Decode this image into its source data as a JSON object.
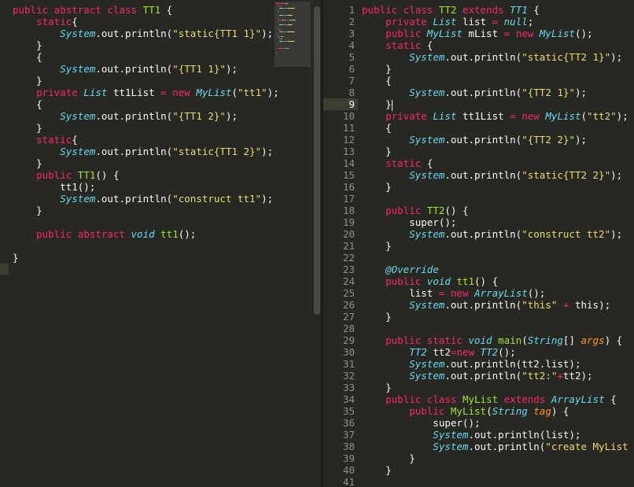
{
  "left_editor": {
    "lines": [
      [
        {
          "t": "public abstract class ",
          "c": "kw"
        },
        {
          "t": "TT1",
          "c": "fn"
        },
        {
          "t": " {",
          "c": "pl"
        }
      ],
      [
        {
          "t": "    ",
          "c": "pl"
        },
        {
          "t": "static",
          "c": "kw"
        },
        {
          "t": "{",
          "c": "pl"
        }
      ],
      [
        {
          "t": "        ",
          "c": "pl"
        },
        {
          "t": "System",
          "c": "ty"
        },
        {
          "t": ".out.println(",
          "c": "pl"
        },
        {
          "t": "\"static{TT1 1}\"",
          "c": "st"
        },
        {
          "t": ");",
          "c": "pl"
        }
      ],
      [
        {
          "t": "    }",
          "c": "pl"
        }
      ],
      [
        {
          "t": "    {",
          "c": "pl"
        }
      ],
      [
        {
          "t": "        ",
          "c": "pl"
        },
        {
          "t": "System",
          "c": "ty"
        },
        {
          "t": ".out.println(",
          "c": "pl"
        },
        {
          "t": "\"{TT1 1}\"",
          "c": "st"
        },
        {
          "t": ");",
          "c": "pl"
        }
      ],
      [
        {
          "t": "    }",
          "c": "pl"
        }
      ],
      [
        {
          "t": "    ",
          "c": "pl"
        },
        {
          "t": "private ",
          "c": "kw"
        },
        {
          "t": "List",
          "c": "ty"
        },
        {
          "t": " tt1List ",
          "c": "pl"
        },
        {
          "t": "=",
          "c": "op"
        },
        {
          "t": " ",
          "c": "pl"
        },
        {
          "t": "new ",
          "c": "kw"
        },
        {
          "t": "MyList",
          "c": "ty"
        },
        {
          "t": "(",
          "c": "pl"
        },
        {
          "t": "\"tt1\"",
          "c": "st"
        },
        {
          "t": ");",
          "c": "pl"
        }
      ],
      [
        {
          "t": "    {",
          "c": "pl"
        }
      ],
      [
        {
          "t": "        ",
          "c": "pl"
        },
        {
          "t": "System",
          "c": "ty"
        },
        {
          "t": ".out.println(",
          "c": "pl"
        },
        {
          "t": "\"{TT1 2}\"",
          "c": "st"
        },
        {
          "t": ");",
          "c": "pl"
        }
      ],
      [
        {
          "t": "    }",
          "c": "pl"
        }
      ],
      [
        {
          "t": "    ",
          "c": "pl"
        },
        {
          "t": "static",
          "c": "kw"
        },
        {
          "t": "{",
          "c": "pl"
        }
      ],
      [
        {
          "t": "        ",
          "c": "pl"
        },
        {
          "t": "System",
          "c": "ty"
        },
        {
          "t": ".out.println(",
          "c": "pl"
        },
        {
          "t": "\"static{TT1 2}\"",
          "c": "st"
        },
        {
          "t": ");",
          "c": "pl"
        }
      ],
      [
        {
          "t": "    }",
          "c": "pl"
        }
      ],
      [
        {
          "t": "    ",
          "c": "pl"
        },
        {
          "t": "public ",
          "c": "kw"
        },
        {
          "t": "TT1",
          "c": "fn"
        },
        {
          "t": "() {",
          "c": "pl"
        }
      ],
      [
        {
          "t": "        tt1();",
          "c": "pl"
        }
      ],
      [
        {
          "t": "        ",
          "c": "pl"
        },
        {
          "t": "System",
          "c": "ty"
        },
        {
          "t": ".out.println(",
          "c": "pl"
        },
        {
          "t": "\"construct tt1\"",
          "c": "st"
        },
        {
          "t": ");",
          "c": "pl"
        }
      ],
      [
        {
          "t": "    }",
          "c": "pl"
        }
      ],
      [
        {
          "t": "",
          "c": "pl"
        }
      ],
      [
        {
          "t": "    ",
          "c": "pl"
        },
        {
          "t": "public abstract ",
          "c": "kw"
        },
        {
          "t": "void",
          "c": "ty"
        },
        {
          "t": " ",
          "c": "pl"
        },
        {
          "t": "tt1",
          "c": "fn"
        },
        {
          "t": "();",
          "c": "pl"
        }
      ],
      [
        {
          "t": "",
          "c": "pl"
        }
      ],
      [
        {
          "t": "}",
          "c": "pl"
        }
      ]
    ]
  },
  "right_editor": {
    "active_line": 9,
    "lines": [
      [
        {
          "t": "public class ",
          "c": "kw"
        },
        {
          "t": "TT2",
          "c": "fn"
        },
        {
          "t": " ",
          "c": "pl"
        },
        {
          "t": "extends ",
          "c": "kw"
        },
        {
          "t": "TT1",
          "c": "ty"
        },
        {
          "t": " {",
          "c": "pl"
        }
      ],
      [
        {
          "t": "    ",
          "c": "pl"
        },
        {
          "t": "private ",
          "c": "kw"
        },
        {
          "t": "List",
          "c": "ty"
        },
        {
          "t": " list ",
          "c": "pl"
        },
        {
          "t": "=",
          "c": "op"
        },
        {
          "t": " ",
          "c": "pl"
        },
        {
          "t": "null",
          "c": "ty"
        },
        {
          "t": ";",
          "c": "pl"
        }
      ],
      [
        {
          "t": "    ",
          "c": "pl"
        },
        {
          "t": "public ",
          "c": "kw"
        },
        {
          "t": "MyList",
          "c": "ty"
        },
        {
          "t": " mList ",
          "c": "pl"
        },
        {
          "t": "=",
          "c": "op"
        },
        {
          "t": " ",
          "c": "pl"
        },
        {
          "t": "new ",
          "c": "kw"
        },
        {
          "t": "MyList",
          "c": "ty"
        },
        {
          "t": "();",
          "c": "pl"
        }
      ],
      [
        {
          "t": "    ",
          "c": "pl"
        },
        {
          "t": "static",
          "c": "kw"
        },
        {
          "t": " {",
          "c": "pl"
        }
      ],
      [
        {
          "t": "        ",
          "c": "pl"
        },
        {
          "t": "System",
          "c": "ty"
        },
        {
          "t": ".out.println(",
          "c": "pl"
        },
        {
          "t": "\"static{TT2 1}\"",
          "c": "st"
        },
        {
          "t": ");",
          "c": "pl"
        }
      ],
      [
        {
          "t": "    }",
          "c": "pl"
        }
      ],
      [
        {
          "t": "    {",
          "c": "pl"
        }
      ],
      [
        {
          "t": "        ",
          "c": "pl"
        },
        {
          "t": "System",
          "c": "ty"
        },
        {
          "t": ".out.println(",
          "c": "pl"
        },
        {
          "t": "\"{TT2 1}\"",
          "c": "st"
        },
        {
          "t": ");",
          "c": "pl"
        }
      ],
      [
        {
          "t": "    }",
          "c": "pl",
          "cursor": true
        }
      ],
      [
        {
          "t": "    ",
          "c": "pl"
        },
        {
          "t": "private ",
          "c": "kw"
        },
        {
          "t": "List",
          "c": "ty"
        },
        {
          "t": " tt1List ",
          "c": "pl"
        },
        {
          "t": "=",
          "c": "op"
        },
        {
          "t": " ",
          "c": "pl"
        },
        {
          "t": "new ",
          "c": "kw"
        },
        {
          "t": "MyList",
          "c": "ty"
        },
        {
          "t": "(",
          "c": "pl"
        },
        {
          "t": "\"tt2\"",
          "c": "st"
        },
        {
          "t": ");",
          "c": "pl"
        }
      ],
      [
        {
          "t": "    {",
          "c": "pl"
        }
      ],
      [
        {
          "t": "        ",
          "c": "pl"
        },
        {
          "t": "System",
          "c": "ty"
        },
        {
          "t": ".out.println(",
          "c": "pl"
        },
        {
          "t": "\"{TT2 2}\"",
          "c": "st"
        },
        {
          "t": ");",
          "c": "pl"
        }
      ],
      [
        {
          "t": "    }",
          "c": "pl"
        }
      ],
      [
        {
          "t": "    ",
          "c": "pl"
        },
        {
          "t": "static",
          "c": "kw"
        },
        {
          "t": " {",
          "c": "pl"
        }
      ],
      [
        {
          "t": "        ",
          "c": "pl"
        },
        {
          "t": "System",
          "c": "ty"
        },
        {
          "t": ".out.println(",
          "c": "pl"
        },
        {
          "t": "\"static{TT2 2}\"",
          "c": "st"
        },
        {
          "t": ");",
          "c": "pl"
        }
      ],
      [
        {
          "t": "    }",
          "c": "pl"
        }
      ],
      [
        {
          "t": "",
          "c": "pl"
        }
      ],
      [
        {
          "t": "    ",
          "c": "pl"
        },
        {
          "t": "public ",
          "c": "kw"
        },
        {
          "t": "TT2",
          "c": "fn"
        },
        {
          "t": "() {",
          "c": "pl"
        }
      ],
      [
        {
          "t": "        super();",
          "c": "pl"
        }
      ],
      [
        {
          "t": "        ",
          "c": "pl"
        },
        {
          "t": "System",
          "c": "ty"
        },
        {
          "t": ".out.println(",
          "c": "pl"
        },
        {
          "t": "\"construct tt2\"",
          "c": "st"
        },
        {
          "t": ");",
          "c": "pl"
        }
      ],
      [
        {
          "t": "    }",
          "c": "pl"
        }
      ],
      [
        {
          "t": "",
          "c": "pl"
        }
      ],
      [
        {
          "t": "    ",
          "c": "pl"
        },
        {
          "t": "@Override",
          "c": "an"
        }
      ],
      [
        {
          "t": "    ",
          "c": "pl"
        },
        {
          "t": "public ",
          "c": "kw"
        },
        {
          "t": "void",
          "c": "ty"
        },
        {
          "t": " ",
          "c": "pl"
        },
        {
          "t": "tt1",
          "c": "fn"
        },
        {
          "t": "() {",
          "c": "pl"
        }
      ],
      [
        {
          "t": "        list ",
          "c": "pl"
        },
        {
          "t": "=",
          "c": "op"
        },
        {
          "t": " ",
          "c": "pl"
        },
        {
          "t": "new ",
          "c": "kw"
        },
        {
          "t": "ArrayList",
          "c": "ty"
        },
        {
          "t": "();",
          "c": "pl"
        }
      ],
      [
        {
          "t": "        ",
          "c": "pl"
        },
        {
          "t": "System",
          "c": "ty"
        },
        {
          "t": ".out.println(",
          "c": "pl"
        },
        {
          "t": "\"this\"",
          "c": "st"
        },
        {
          "t": " ",
          "c": "pl"
        },
        {
          "t": "+",
          "c": "op"
        },
        {
          "t": " this);",
          "c": "pl"
        }
      ],
      [
        {
          "t": "    }",
          "c": "pl"
        }
      ],
      [
        {
          "t": "",
          "c": "pl"
        }
      ],
      [
        {
          "t": "    ",
          "c": "pl"
        },
        {
          "t": "public static ",
          "c": "kw"
        },
        {
          "t": "void",
          "c": "ty"
        },
        {
          "t": " ",
          "c": "pl"
        },
        {
          "t": "main",
          "c": "fn"
        },
        {
          "t": "(",
          "c": "pl"
        },
        {
          "t": "String",
          "c": "ty"
        },
        {
          "t": "[] ",
          "c": "pl"
        },
        {
          "t": "args",
          "c": "ar"
        },
        {
          "t": ") {",
          "c": "pl"
        }
      ],
      [
        {
          "t": "        ",
          "c": "pl"
        },
        {
          "t": "TT2",
          "c": "ty"
        },
        {
          "t": " tt2",
          "c": "pl"
        },
        {
          "t": "=",
          "c": "op"
        },
        {
          "t": "new ",
          "c": "kw"
        },
        {
          "t": "TT2",
          "c": "ty"
        },
        {
          "t": "();",
          "c": "pl"
        }
      ],
      [
        {
          "t": "        ",
          "c": "pl"
        },
        {
          "t": "System",
          "c": "ty"
        },
        {
          "t": ".out.println(tt2.list);",
          "c": "pl"
        }
      ],
      [
        {
          "t": "        ",
          "c": "pl"
        },
        {
          "t": "System",
          "c": "ty"
        },
        {
          "t": ".out.println(",
          "c": "pl"
        },
        {
          "t": "\"tt2:\"",
          "c": "st"
        },
        {
          "t": "+",
          "c": "op"
        },
        {
          "t": "tt2);",
          "c": "pl"
        }
      ],
      [
        {
          "t": "    }",
          "c": "pl"
        }
      ],
      [
        {
          "t": "    ",
          "c": "pl"
        },
        {
          "t": "public class ",
          "c": "kw"
        },
        {
          "t": "MyList",
          "c": "fn"
        },
        {
          "t": " ",
          "c": "pl"
        },
        {
          "t": "extends ",
          "c": "kw"
        },
        {
          "t": "ArrayList",
          "c": "ty"
        },
        {
          "t": " {",
          "c": "pl"
        }
      ],
      [
        {
          "t": "        ",
          "c": "pl"
        },
        {
          "t": "public ",
          "c": "kw"
        },
        {
          "t": "MyList",
          "c": "fn"
        },
        {
          "t": "(",
          "c": "pl"
        },
        {
          "t": "String",
          "c": "ty"
        },
        {
          "t": " ",
          "c": "pl"
        },
        {
          "t": "tag",
          "c": "ar"
        },
        {
          "t": ") {",
          "c": "pl"
        }
      ],
      [
        {
          "t": "            super();",
          "c": "pl"
        }
      ],
      [
        {
          "t": "            ",
          "c": "pl"
        },
        {
          "t": "System",
          "c": "ty"
        },
        {
          "t": ".out.println(list);",
          "c": "pl"
        }
      ],
      [
        {
          "t": "            ",
          "c": "pl"
        },
        {
          "t": "System",
          "c": "ty"
        },
        {
          "t": ".out.println(",
          "c": "pl"
        },
        {
          "t": "\"create MyList \"",
          "c": "st"
        },
        {
          "t": " ",
          "c": "pl"
        },
        {
          "t": "+",
          "c": "op"
        }
      ],
      [
        {
          "t": "        }",
          "c": "pl"
        }
      ],
      [
        {
          "t": "    }",
          "c": "pl"
        }
      ],
      [
        {
          "t": "",
          "c": "pl"
        }
      ]
    ]
  },
  "colors": {
    "background": "#272822",
    "keyword": "#f92672",
    "type": "#66d9ef",
    "string": "#e6db74",
    "function": "#a6e22e",
    "argument": "#fd971f",
    "text": "#f8f8f2",
    "gutter_text": "#90908a",
    "active_line": "#3e3d32"
  }
}
